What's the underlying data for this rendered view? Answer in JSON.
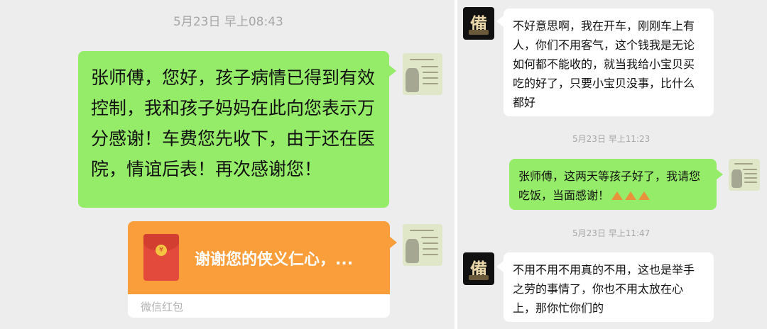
{
  "left": {
    "timestamp": "5月23日 早上08:43",
    "message": "张师傅，您好，孩子病情已得到有效控制，我和孩子妈妈在此向您表示万分感谢！车费您先收下，由于还在医院，情谊后表！再次感谢您！",
    "red_packet": {
      "greeting": "谢谢您的侠义仁心，...",
      "footer": "微信红包"
    }
  },
  "right": {
    "messages": [
      {
        "sender": "driver",
        "text": "不好意思啊，我在开车，刚刚车上有人，你们不用客气，这个钱我是无论如何都不能收的，就当我给小宝贝买吃的好了，只要小宝贝没事，比什么都好"
      },
      {
        "timestamp": "5月23日 早上11:23"
      },
      {
        "sender": "me",
        "text": "张师傅，这两天等孩子好了，我请您吃饭，当面感谢！",
        "emoji": [
          "clap-icon",
          "clap-icon",
          "clap-icon"
        ]
      },
      {
        "timestamp": "5月23日 早上11:47"
      },
      {
        "sender": "driver",
        "text": "不用不用不用真的不用，这也是举手之劳的事情了，你也不用太放在心上，那你忙你们的"
      }
    ]
  },
  "colors": {
    "chat_background": "#ededed",
    "sent_bubble": "#95ec69",
    "received_bubble": "#ffffff",
    "red_packet": "#fa9d3b",
    "timestamp": "#a6a6a6"
  },
  "avatars": {
    "driver_glyph": "備"
  }
}
